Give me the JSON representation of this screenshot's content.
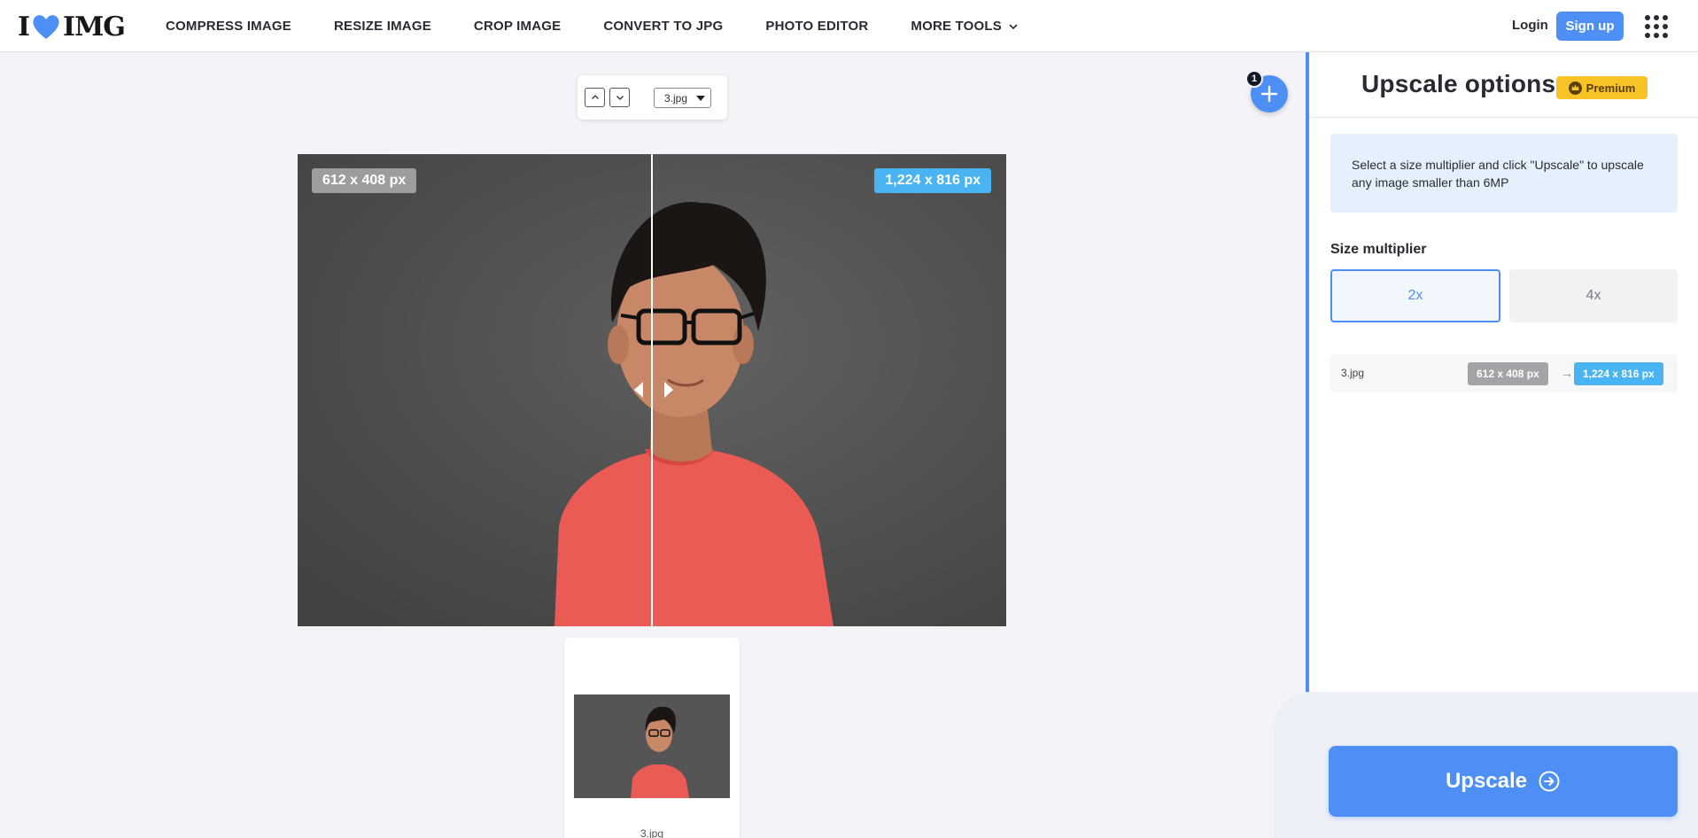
{
  "header": {
    "logo": {
      "left": "I",
      "right": "IMG",
      "heart_color": "#4d8ff5"
    },
    "nav": [
      {
        "label": "COMPRESS IMAGE"
      },
      {
        "label": "RESIZE IMAGE"
      },
      {
        "label": "CROP IMAGE"
      },
      {
        "label": "CONVERT TO JPG"
      },
      {
        "label": "PHOTO EDITOR"
      },
      {
        "label": "MORE TOOLS"
      }
    ],
    "login": "Login",
    "signup": "Sign up"
  },
  "toolbar": {
    "file_select": "3.jpg"
  },
  "add_files": {
    "count": "1"
  },
  "compare": {
    "original_size": "612 x 408 px",
    "upscaled_size": "1,224 x 816 px"
  },
  "thumbnail": {
    "name": "3.jpg"
  },
  "panel": {
    "title": "Upscale options",
    "premium": "Premium",
    "info": "Select a size multiplier and click \"Upscale\" to upscale any image smaller than 6MP",
    "size_label": "Size multiplier",
    "multipliers": [
      {
        "label": "2x",
        "selected": true
      },
      {
        "label": "4x",
        "selected": false
      }
    ],
    "file": {
      "name": "3.jpg",
      "from": "612 x 408 px",
      "arrow": "→",
      "to": "1,224 x 816 px"
    },
    "upscale_button": "Upscale"
  },
  "colors": {
    "accent": "#4d8ff5",
    "premium": "#f8c327",
    "size_badge_target": "#4ab3f2",
    "size_badge_source": "#a4a4a8"
  },
  "icons": [
    "heart-icon",
    "chevron-down-icon",
    "apps-grid-icon",
    "chevron-up-icon",
    "plus-icon",
    "crown-icon",
    "arrow-circle-right-icon"
  ]
}
